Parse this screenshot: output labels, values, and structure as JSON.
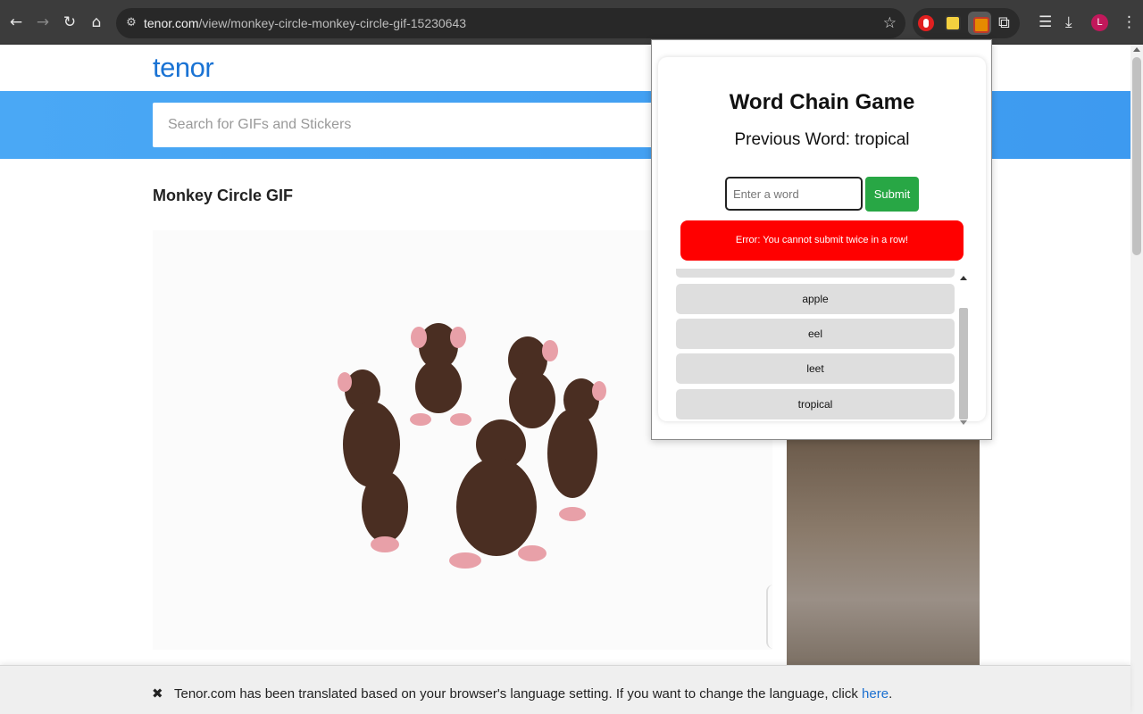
{
  "browser": {
    "url_host": "tenor.com",
    "url_path": "/view/monkey-circle-monkey-circle-gif-15230643",
    "avatar_letter": "L",
    "icons": {
      "back": "back-arrow-icon",
      "forward": "forward-arrow-icon",
      "reload": "reload-icon",
      "home": "home-icon",
      "site_info": "site-settings-icon",
      "bookmark": "star-icon",
      "extensions": "puzzle-icon",
      "media": "media-control-icon",
      "downloads": "download-icon",
      "menu": "kebab-menu-icon"
    }
  },
  "page": {
    "logo": "tenor",
    "search_placeholder": "Search for GIFs and Stickers",
    "gif_title": "Monkey Circle GIF"
  },
  "popup": {
    "title": "Word Chain Game",
    "previous_word": "Previous Word: tropical",
    "input_placeholder": "Enter a word",
    "submit_label": "Submit",
    "error_message": "Error: You cannot submit twice in a row!",
    "words": [
      "apple",
      "eel",
      "leet",
      "tropical"
    ]
  },
  "translate_bar": {
    "message": "Tenor.com has been translated based on your browser's language setting. If you want to change the language, click ",
    "link_text": "here",
    "period": "."
  },
  "colors": {
    "chrome_bg": "#3c3c3c",
    "tenor_blue": "#1a73d4",
    "search_band": "#4aa8f5",
    "submit_green": "#28a745",
    "error_red": "#ff0000",
    "word_item_bg": "#dedede"
  }
}
